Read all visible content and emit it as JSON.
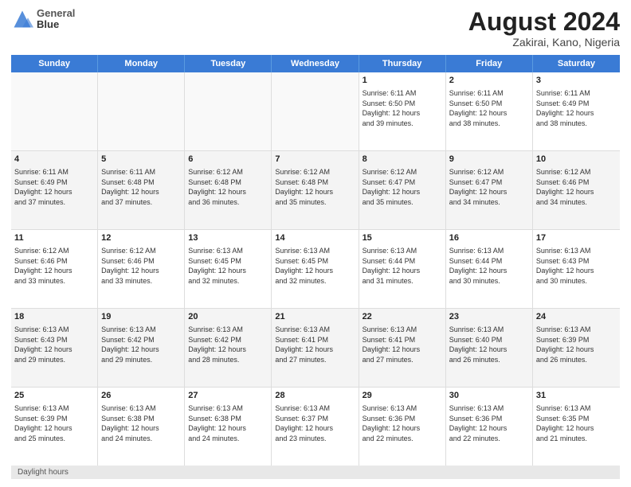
{
  "header": {
    "logo_line1": "General",
    "logo_line2": "Blue",
    "main_title": "August 2024",
    "subtitle": "Zakirai, Kano, Nigeria"
  },
  "days_of_week": [
    "Sunday",
    "Monday",
    "Tuesday",
    "Wednesday",
    "Thursday",
    "Friday",
    "Saturday"
  ],
  "weeks": [
    [
      {
        "day": "",
        "info": "",
        "empty": true
      },
      {
        "day": "",
        "info": "",
        "empty": true
      },
      {
        "day": "",
        "info": "",
        "empty": true
      },
      {
        "day": "",
        "info": "",
        "empty": true
      },
      {
        "day": "1",
        "info": "Sunrise: 6:11 AM\nSunset: 6:50 PM\nDaylight: 12 hours\nand 39 minutes."
      },
      {
        "day": "2",
        "info": "Sunrise: 6:11 AM\nSunset: 6:50 PM\nDaylight: 12 hours\nand 38 minutes."
      },
      {
        "day": "3",
        "info": "Sunrise: 6:11 AM\nSunset: 6:49 PM\nDaylight: 12 hours\nand 38 minutes."
      }
    ],
    [
      {
        "day": "4",
        "info": "Sunrise: 6:11 AM\nSunset: 6:49 PM\nDaylight: 12 hours\nand 37 minutes."
      },
      {
        "day": "5",
        "info": "Sunrise: 6:11 AM\nSunset: 6:48 PM\nDaylight: 12 hours\nand 37 minutes."
      },
      {
        "day": "6",
        "info": "Sunrise: 6:12 AM\nSunset: 6:48 PM\nDaylight: 12 hours\nand 36 minutes."
      },
      {
        "day": "7",
        "info": "Sunrise: 6:12 AM\nSunset: 6:48 PM\nDaylight: 12 hours\nand 35 minutes."
      },
      {
        "day": "8",
        "info": "Sunrise: 6:12 AM\nSunset: 6:47 PM\nDaylight: 12 hours\nand 35 minutes."
      },
      {
        "day": "9",
        "info": "Sunrise: 6:12 AM\nSunset: 6:47 PM\nDaylight: 12 hours\nand 34 minutes."
      },
      {
        "day": "10",
        "info": "Sunrise: 6:12 AM\nSunset: 6:46 PM\nDaylight: 12 hours\nand 34 minutes."
      }
    ],
    [
      {
        "day": "11",
        "info": "Sunrise: 6:12 AM\nSunset: 6:46 PM\nDaylight: 12 hours\nand 33 minutes."
      },
      {
        "day": "12",
        "info": "Sunrise: 6:12 AM\nSunset: 6:46 PM\nDaylight: 12 hours\nand 33 minutes."
      },
      {
        "day": "13",
        "info": "Sunrise: 6:13 AM\nSunset: 6:45 PM\nDaylight: 12 hours\nand 32 minutes."
      },
      {
        "day": "14",
        "info": "Sunrise: 6:13 AM\nSunset: 6:45 PM\nDaylight: 12 hours\nand 32 minutes."
      },
      {
        "day": "15",
        "info": "Sunrise: 6:13 AM\nSunset: 6:44 PM\nDaylight: 12 hours\nand 31 minutes."
      },
      {
        "day": "16",
        "info": "Sunrise: 6:13 AM\nSunset: 6:44 PM\nDaylight: 12 hours\nand 30 minutes."
      },
      {
        "day": "17",
        "info": "Sunrise: 6:13 AM\nSunset: 6:43 PM\nDaylight: 12 hours\nand 30 minutes."
      }
    ],
    [
      {
        "day": "18",
        "info": "Sunrise: 6:13 AM\nSunset: 6:43 PM\nDaylight: 12 hours\nand 29 minutes."
      },
      {
        "day": "19",
        "info": "Sunrise: 6:13 AM\nSunset: 6:42 PM\nDaylight: 12 hours\nand 29 minutes."
      },
      {
        "day": "20",
        "info": "Sunrise: 6:13 AM\nSunset: 6:42 PM\nDaylight: 12 hours\nand 28 minutes."
      },
      {
        "day": "21",
        "info": "Sunrise: 6:13 AM\nSunset: 6:41 PM\nDaylight: 12 hours\nand 27 minutes."
      },
      {
        "day": "22",
        "info": "Sunrise: 6:13 AM\nSunset: 6:41 PM\nDaylight: 12 hours\nand 27 minutes."
      },
      {
        "day": "23",
        "info": "Sunrise: 6:13 AM\nSunset: 6:40 PM\nDaylight: 12 hours\nand 26 minutes."
      },
      {
        "day": "24",
        "info": "Sunrise: 6:13 AM\nSunset: 6:39 PM\nDaylight: 12 hours\nand 26 minutes."
      }
    ],
    [
      {
        "day": "25",
        "info": "Sunrise: 6:13 AM\nSunset: 6:39 PM\nDaylight: 12 hours\nand 25 minutes."
      },
      {
        "day": "26",
        "info": "Sunrise: 6:13 AM\nSunset: 6:38 PM\nDaylight: 12 hours\nand 24 minutes."
      },
      {
        "day": "27",
        "info": "Sunrise: 6:13 AM\nSunset: 6:38 PM\nDaylight: 12 hours\nand 24 minutes."
      },
      {
        "day": "28",
        "info": "Sunrise: 6:13 AM\nSunset: 6:37 PM\nDaylight: 12 hours\nand 23 minutes."
      },
      {
        "day": "29",
        "info": "Sunrise: 6:13 AM\nSunset: 6:36 PM\nDaylight: 12 hours\nand 22 minutes."
      },
      {
        "day": "30",
        "info": "Sunrise: 6:13 AM\nSunset: 6:36 PM\nDaylight: 12 hours\nand 22 minutes."
      },
      {
        "day": "31",
        "info": "Sunrise: 6:13 AM\nSunset: 6:35 PM\nDaylight: 12 hours\nand 21 minutes."
      }
    ]
  ],
  "note": "Daylight hours"
}
